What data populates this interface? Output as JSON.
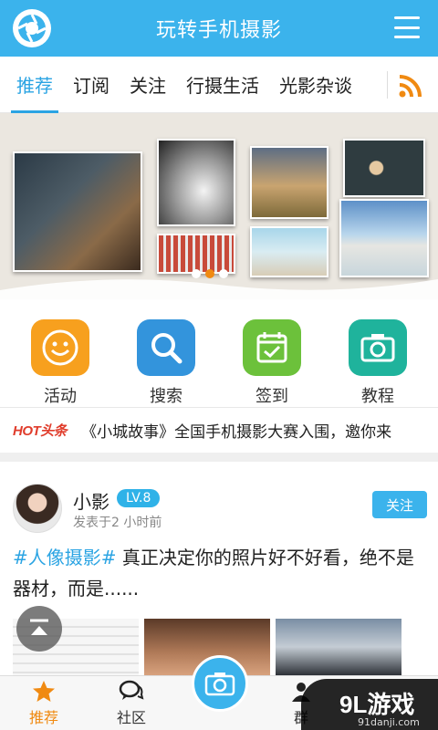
{
  "header": {
    "title": "玩转手机摄影",
    "logo_icon": "camera-aperture-icon",
    "menu_icon": "hamburger-menu-icon"
  },
  "tabs": [
    {
      "label": "推荐",
      "active": true
    },
    {
      "label": "订阅",
      "active": false
    },
    {
      "label": "关注",
      "active": false
    },
    {
      "label": "行摄生活",
      "active": false
    },
    {
      "label": "光影杂谈",
      "active": false
    }
  ],
  "tabs_extra_icon": "rss-icon",
  "banner": {
    "slides_total": 3,
    "active_slide": 2
  },
  "quick_actions": [
    {
      "label": "活动",
      "icon": "smiley-icon",
      "color": "#f7a01e"
    },
    {
      "label": "搜索",
      "icon": "search-icon",
      "color": "#3394dc"
    },
    {
      "label": "签到",
      "icon": "calendar-check-icon",
      "color": "#6cc13b"
    },
    {
      "label": "教程",
      "icon": "camera-icon",
      "color": "#1fb39c"
    }
  ],
  "ticker": {
    "badge": "HOT头条",
    "text": "《小城故事》全国手机摄影大赛入围，邀你来"
  },
  "post": {
    "username": "小影",
    "level": "LV.8",
    "time": "发表于2 小时前",
    "follow_label": "关注",
    "tag": "#人像摄影#",
    "body": " 真正决定你的照片好不好看，绝不是器材，而是......"
  },
  "bottom_nav": [
    {
      "label": "推荐",
      "icon": "star-icon",
      "active": true
    },
    {
      "label": "社区",
      "icon": "chat-bubbles-icon",
      "active": false
    },
    {
      "label": "群",
      "icon": "group-icon",
      "active": false
    }
  ],
  "camera_button_icon": "camera-icon",
  "watermark": {
    "logo": "9L游戏",
    "url": "91danji.com"
  },
  "colors": {
    "primary": "#3bb3ec",
    "accent": "#f08a12",
    "hot": "#e03c2b"
  }
}
